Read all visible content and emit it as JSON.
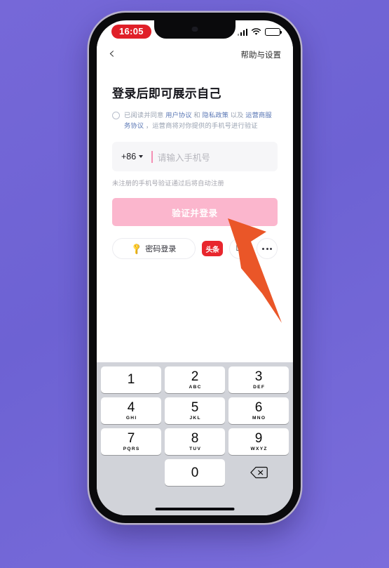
{
  "background": {
    "color": "#6d62d3"
  },
  "status_bar": {
    "time": "16:05",
    "time_badge_color": "#e01f28",
    "icons": [
      "signal-bars-icon",
      "wifi-icon",
      "battery-icon"
    ]
  },
  "nav_bar": {
    "back_icon": "chevron-left-icon",
    "back_label": "‹",
    "help_settings_label": "帮助与设置"
  },
  "main": {
    "title": "登录后即可展示自己",
    "agreement": {
      "checked": false,
      "prefix": "已阅读并同意 ",
      "link1": "用户协议",
      "sep1": " 和 ",
      "link2": "隐私政策",
      "sep2": " 以及 ",
      "link3": "运营商服务协议",
      "suffix": " ，运营商将对你提供的手机号进行验证",
      "link_color": "#5a77b5"
    },
    "phone_input": {
      "country_code": "+86",
      "placeholder": "请输入手机号",
      "value": "",
      "caret_color": "#f48fb4"
    },
    "register_hint": "未注册的手机号验证通过后将自动注册",
    "login_button": {
      "label": "验证并登录",
      "color": "#fbb6cd"
    },
    "alt_login": {
      "password_label": "密码登录",
      "password_icon": "key-icon",
      "toutiao_label": "头条",
      "toutiao_color": "#e8262d",
      "apple_icon": "apple-logo-icon",
      "more_icon": "more-dots-icon"
    }
  },
  "keyboard": {
    "type": "numeric-keypad",
    "keys": [
      {
        "num": "1",
        "letters": ""
      },
      {
        "num": "2",
        "letters": "ABC"
      },
      {
        "num": "3",
        "letters": "DEF"
      },
      {
        "num": "4",
        "letters": "GHI"
      },
      {
        "num": "5",
        "letters": "JKL"
      },
      {
        "num": "6",
        "letters": "MNO"
      },
      {
        "num": "7",
        "letters": "PQRS"
      },
      {
        "num": "8",
        "letters": "TUV"
      },
      {
        "num": "9",
        "letters": "WXYZ"
      },
      {
        "num": "0",
        "letters": ""
      }
    ],
    "delete_icon": "backspace-icon"
  },
  "annotation": {
    "arrow_icon": "pointer-arrow-icon",
    "arrow_color": "#ea5628"
  }
}
